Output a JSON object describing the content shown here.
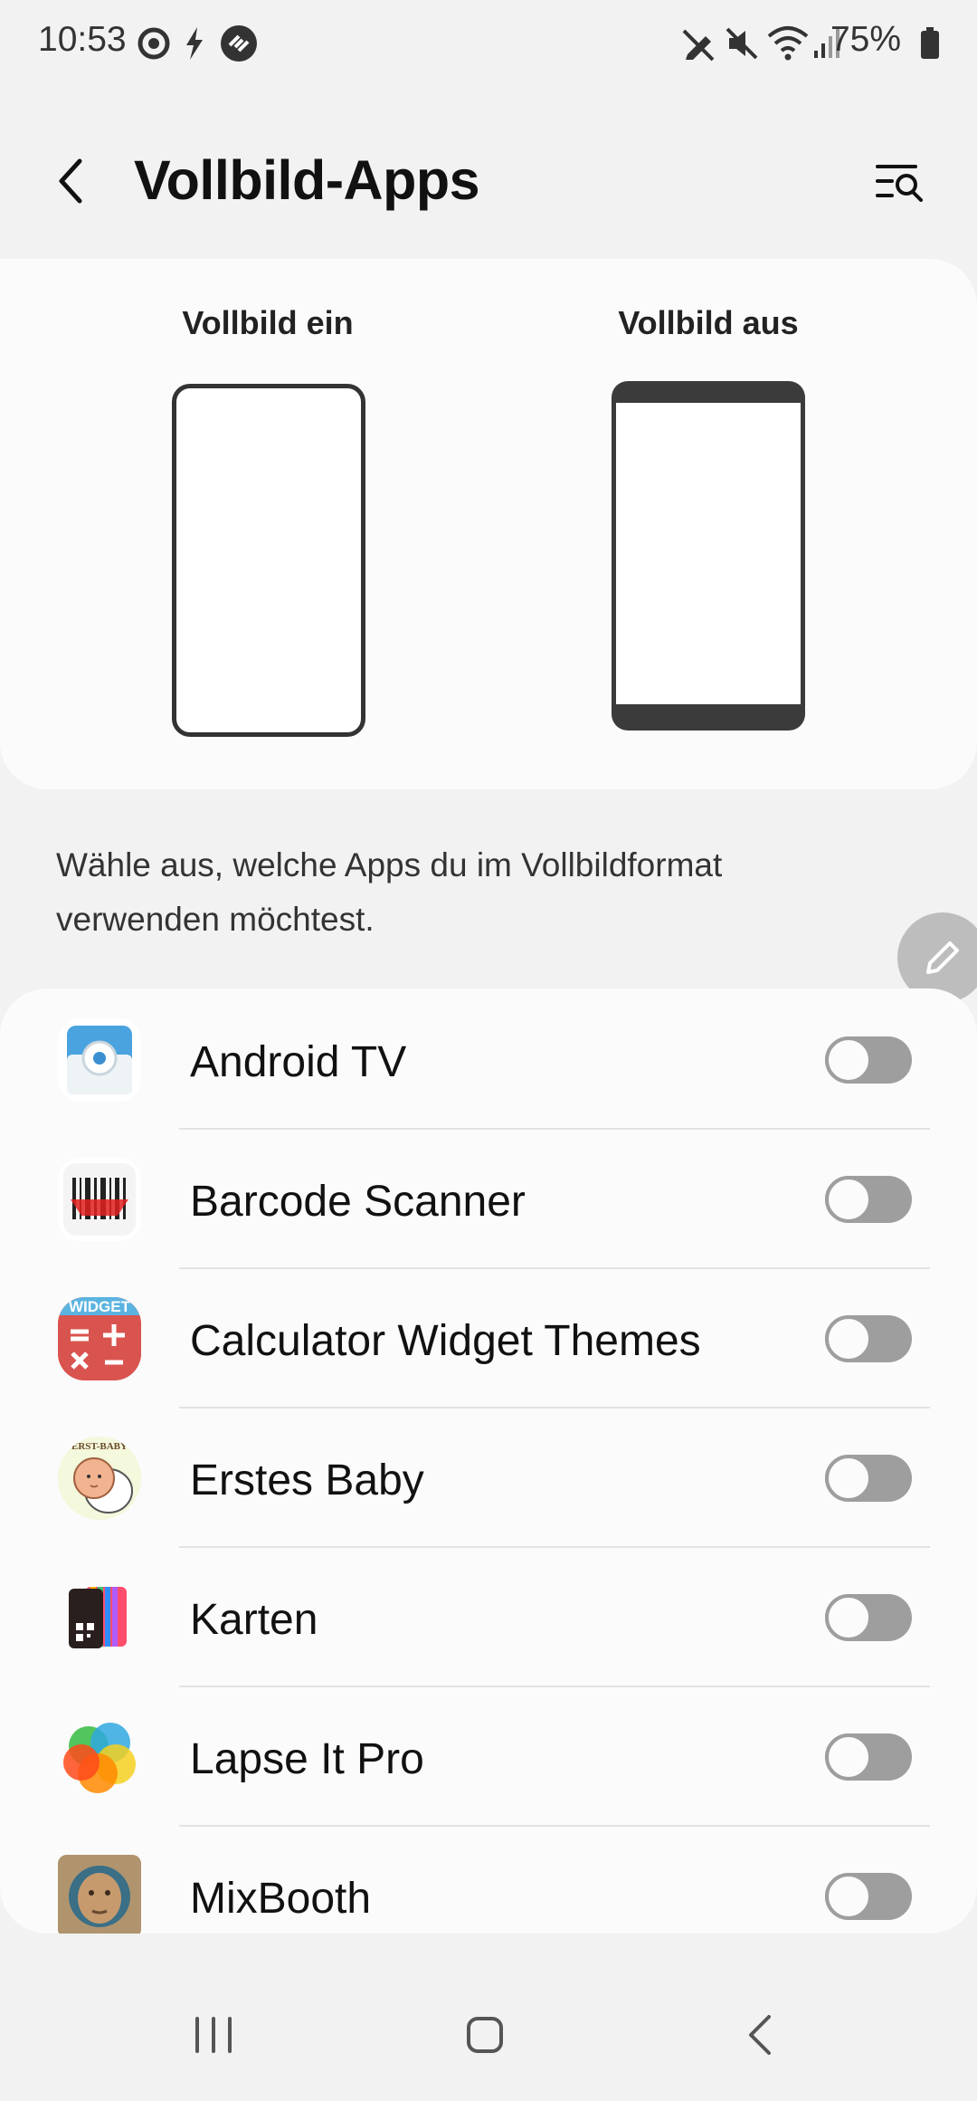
{
  "status_bar": {
    "time": "10:53",
    "battery_percent": "75%"
  },
  "header": {
    "title": "Vollbild-Apps"
  },
  "preview": {
    "on_label": "Vollbild ein",
    "off_label": "Vollbild aus"
  },
  "description": "Wähle aus, welche Apps du im Vollbildformat verwenden möchtest.",
  "apps": [
    {
      "name": "Android TV",
      "enabled": false
    },
    {
      "name": "Barcode Scanner",
      "enabled": false
    },
    {
      "name": "Calculator Widget Themes",
      "enabled": false
    },
    {
      "name": "Erstes Baby",
      "enabled": false
    },
    {
      "name": "Karten",
      "enabled": false
    },
    {
      "name": "Lapse It Pro",
      "enabled": false
    },
    {
      "name": "MixBooth",
      "enabled": false
    }
  ],
  "icon_texts": {
    "calculator_banner": "WIDGET",
    "baby_banner": "ERST-BABY"
  },
  "colors": {
    "background": "#f2f2f2",
    "card": "#fbfbfb",
    "toggle_off": "#9e9e9e",
    "fab": "#bdbdbd"
  }
}
